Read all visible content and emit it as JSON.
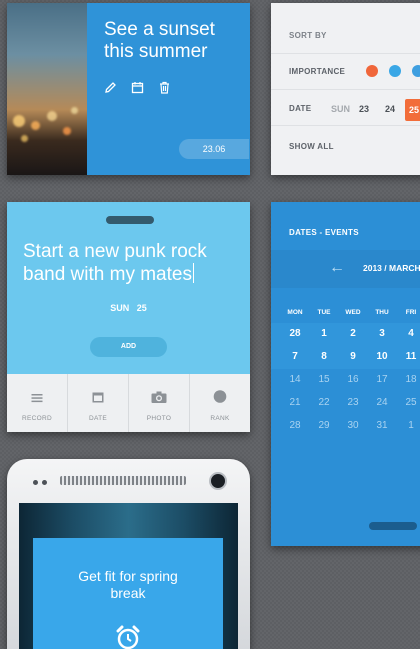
{
  "sunset_card": {
    "title_line1": "See a sunset",
    "title_line2": "this summer",
    "date": "23.06",
    "icons": [
      "pencil-icon",
      "calendar-icon",
      "trash-icon"
    ]
  },
  "sort_card": {
    "sort_by_label": "SORT BY",
    "importance_label": "IMPORTANCE",
    "importance_colors": [
      "#f0663a",
      "#3aa7e6",
      "#3f9fe0"
    ],
    "date_label": "DATE",
    "dates": [
      {
        "label": "SUN",
        "dim": true
      },
      {
        "label": "23",
        "dim": false
      },
      {
        "label": "24",
        "dim": false
      },
      {
        "label": "25",
        "dim": false,
        "selected": true
      }
    ],
    "show_all_label": "SHOW ALL"
  },
  "task_card": {
    "title_line1": "Start a new punk rock",
    "title_line2": "band with my mates",
    "day": "SUN",
    "date": "25",
    "add_label": "ADD",
    "toolbar": [
      {
        "label": "RECORD",
        "icon": "menu-icon"
      },
      {
        "label": "DATE",
        "icon": "calendar-icon"
      },
      {
        "label": "PHOTO",
        "icon": "camera-icon"
      },
      {
        "label": "RANK",
        "icon": "circle-icon"
      }
    ]
  },
  "calendar_card": {
    "header": "DATES - EVENTS",
    "month": "2013 / MARCH",
    "weekdays": [
      "MON",
      "TUE",
      "WED",
      "THU",
      "FRI"
    ],
    "weeks": [
      [
        "28",
        "1",
        "2",
        "3",
        "4"
      ],
      [
        "7",
        "8",
        "9",
        "10",
        "11"
      ],
      [
        "14",
        "15",
        "16",
        "17",
        "18"
      ],
      [
        "21",
        "22",
        "23",
        "24",
        "25"
      ],
      [
        "28",
        "29",
        "30",
        "31",
        "1"
      ]
    ],
    "colors": {
      "bright": "#ffffff",
      "dim": "#a9d3f1"
    }
  },
  "phone": {
    "screen_title_line1": "Get fit for spring",
    "screen_title_line2": "break",
    "icon": "alarm-clock-icon"
  }
}
